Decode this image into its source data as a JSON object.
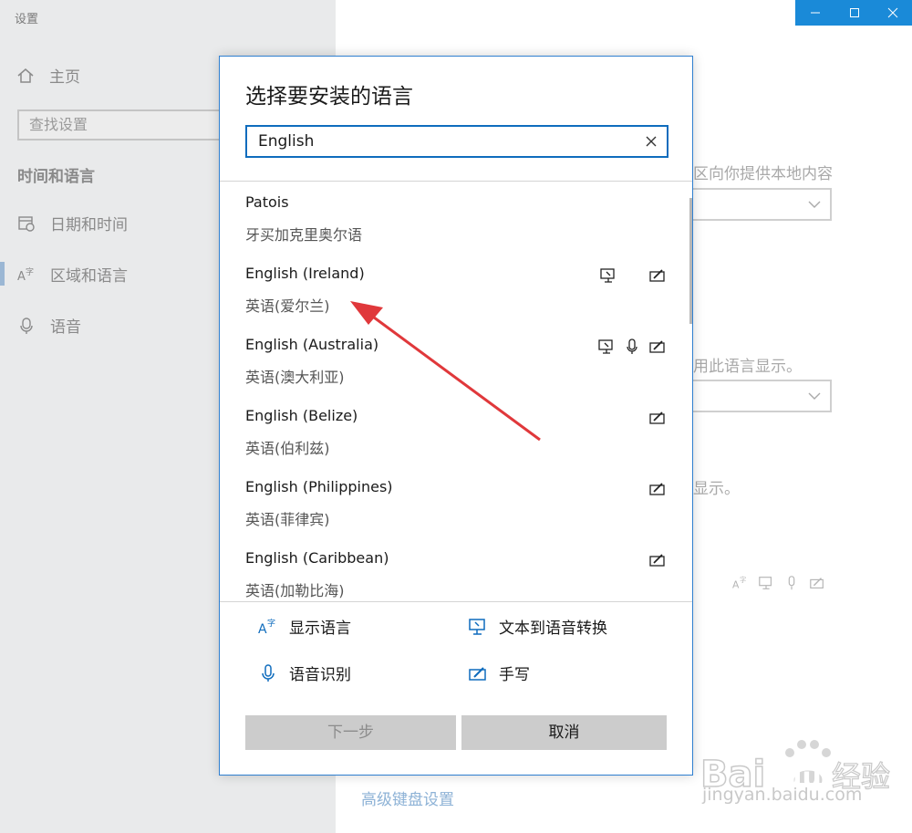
{
  "app": {
    "title": "设置"
  },
  "sidebar": {
    "home_label": "主页",
    "search_placeholder": "查找设置",
    "section_title": "时间和语言",
    "items": [
      {
        "label": "日期和时间",
        "icon": "calendar-clock-icon"
      },
      {
        "label": "区域和语言",
        "icon": "language-icon",
        "active": true
      },
      {
        "label": "语音",
        "icon": "microphone-icon"
      }
    ]
  },
  "background": {
    "text_local_content": "区向你提供本地内容",
    "text_display_lang": "用此语言显示。",
    "text_display": "显示。",
    "link_keyboard": "高级键盘设置"
  },
  "dialog": {
    "title": "选择要安装的语言",
    "search_value": "English",
    "languages": [
      {
        "en": "Patois",
        "zh": "牙买加克里奥尔语",
        "features": []
      },
      {
        "en": "English (Ireland)",
        "zh": "英语(爱尔兰)",
        "features": [
          "text-to-speech-icon",
          "handwriting-icon"
        ]
      },
      {
        "en": "English (Australia)",
        "zh": "英语(澳大利亚)",
        "features": [
          "text-to-speech-icon",
          "speech-recognition-icon",
          "handwriting-icon"
        ]
      },
      {
        "en": "English (Belize)",
        "zh": "英语(伯利兹)",
        "features": [
          "handwriting-icon"
        ]
      },
      {
        "en": "English (Philippines)",
        "zh": "英语(菲律宾)",
        "features": [
          "handwriting-icon"
        ]
      },
      {
        "en": "English (Caribbean)",
        "zh": "英语(加勒比海)",
        "features": [
          "handwriting-icon"
        ]
      }
    ],
    "legend": {
      "display_language": "显示语言",
      "text_to_speech": "文本到语音转换",
      "speech_recognition": "语音识别",
      "handwriting": "手写"
    },
    "buttons": {
      "next": "下一步",
      "cancel": "取消"
    }
  },
  "watermark": {
    "text": "jingyan.baidu.com",
    "brand": "Bai du 经验"
  },
  "colors": {
    "accent": "#0f6cbd",
    "titlebar": "#1a8ad8",
    "annotation_arrow": "#e0383b"
  }
}
